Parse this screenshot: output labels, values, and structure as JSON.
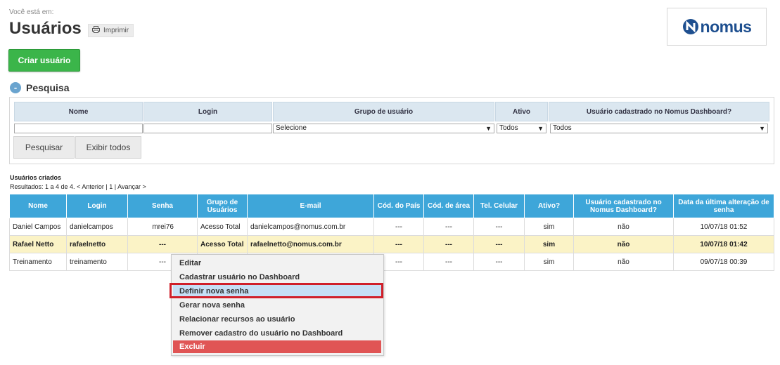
{
  "header": {
    "breadcrumb_label": "Você está em:",
    "title": "Usuários",
    "print_label": "Imprimir",
    "logo_text": "nomus"
  },
  "actions": {
    "create_user_label": "Criar usuário"
  },
  "search": {
    "section_title": "Pesquisa",
    "toggle_symbol": "-",
    "columns": [
      "Nome",
      "Login",
      "Grupo de usuário",
      "Ativo",
      "Usuário cadastrado no Nomus Dashboard?"
    ],
    "group_select_value": "Selecione",
    "active_select_value": "Todos",
    "dashboard_select_value": "Todos",
    "search_button": "Pesquisar",
    "show_all_button": "Exibir todos"
  },
  "results": {
    "title": "Usuários criados",
    "summary": "Resultados: 1 a 4 de 4.",
    "prev": "< Anterior",
    "sep1": "|",
    "page": "1",
    "sep2": "|",
    "next": "Avançar >"
  },
  "table": {
    "headers": [
      "Nome",
      "Login",
      "Senha",
      "Grupo de Usuários",
      "E-mail",
      "Cód. do País",
      "Cód. de área",
      "Tel. Celular",
      "Ativo?",
      "Usuário cadastrado no Nomus Dashboard?",
      "Data da última alteração de senha"
    ],
    "rows": [
      [
        "Daniel Campos",
        "danielcampos",
        "mrei76",
        "Acesso Total",
        "danielcampos@nomus.com.br",
        "---",
        "---",
        "---",
        "sim",
        "não",
        "10/07/18 01:52"
      ],
      [
        "Rafael Netto",
        "rafaelnetto",
        "---",
        "Acesso Total",
        "rafaelnetto@nomus.com.br",
        "---",
        "---",
        "---",
        "sim",
        "não",
        "10/07/18 01:42"
      ],
      [
        "Treinamento",
        "treinamento",
        "---",
        "",
        "",
        "---",
        "---",
        "---",
        "sim",
        "não",
        "09/07/18 00:39"
      ]
    ]
  },
  "context_menu": {
    "items": [
      "Editar",
      "Cadastrar usuário no Dashboard",
      "Definir nova senha",
      "Gerar nova senha",
      "Relacionar recursos ao usuário",
      "Remover cadastro do usuário no Dashboard",
      "Excluir"
    ]
  },
  "colors": {
    "header_blue": "#3ea6d9",
    "create_green": "#3bb54a",
    "highlight_row": "#fbf3c6",
    "danger": "#e05555",
    "annotation_red": "#d0202a"
  }
}
